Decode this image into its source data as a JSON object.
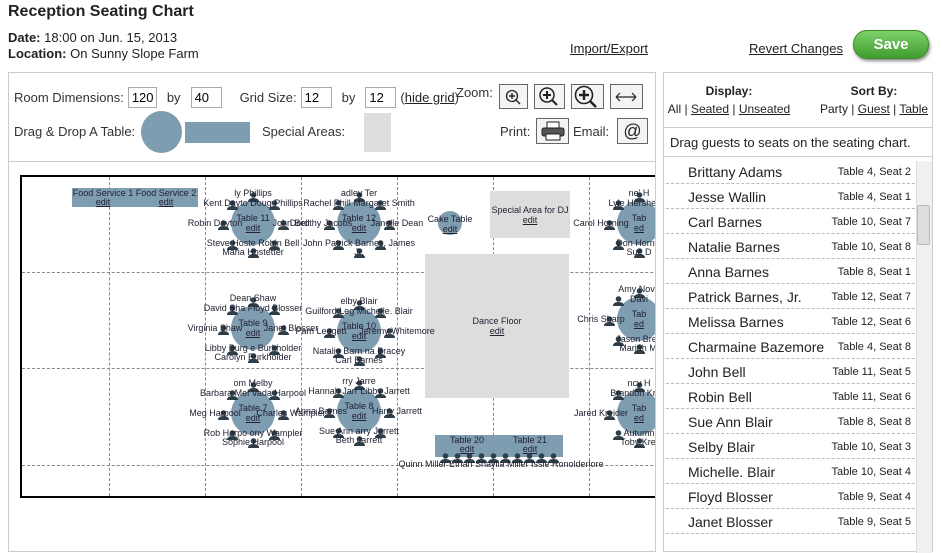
{
  "header": {
    "title": "Reception Seating Chart",
    "date_label": "Date:",
    "date": "18:00 on Jun. 15, 2013",
    "location_label": "Location:",
    "location": "On Sunny Slope Farm",
    "import_export": "Import/Export",
    "revert": "Revert Changes",
    "save": "Save"
  },
  "toolbar": {
    "room_label": "Room Dimensions:",
    "room_w": "120",
    "by1": "by",
    "room_h": "40",
    "grid_label": "Grid Size:",
    "grid_w": "12",
    "by2": "by",
    "grid_h": "12",
    "hide_grid": "hide grid",
    "zoom_label": "Zoom:",
    "drag_label": "Drag & Drop A Table:",
    "special_label": "Special Areas:",
    "print_label": "Print:",
    "email_label": "Email:"
  },
  "colors": {
    "table": "#7f9db0",
    "special_area": "#dddddd",
    "save": "#4aa838"
  },
  "chart": {
    "round_tables": [
      {
        "name": "Table 11",
        "edit": "edit",
        "lines": [
          "ly Phillips",
          "Kent Dayto Doug Phillips",
          "Robin Dayton",
          "John Bell",
          "Steve Hoste Robin Bell",
          "Maria Hostetter"
        ]
      },
      {
        "name": "Table 12",
        "edit": "edit",
        "lines": [
          "adley Ter",
          "Rachel Phill Margaret Smith",
          "Dorothy Jacobs",
          "Janelle Dean",
          "John Patrick Barnes, James",
          "Jr."
        ]
      },
      {
        "name": "Table 9",
        "edit": "edit",
        "lines": [
          "Dean Shaw",
          "David Sha Floyd Blosser",
          "Virginia Shaw",
          "Janet Blosser",
          "Libby Burg e Burkholder",
          "Carolyn Burkholder"
        ]
      },
      {
        "name": "Table 10",
        "edit": "edit",
        "lines": [
          "elby Blair",
          "Guilford Leg Michelle. Blair",
          "Pam Leggett",
          "Jeremy Whitemore",
          "Natalie Barn na Bracey",
          "Carl Barnes"
        ]
      },
      {
        "name": "Table 7",
        "edit": "edit",
        "lines": [
          "om Melby",
          "Barbara Mel Vada Harpool",
          "Meg Harpool",
          "Charles Wampler",
          "Rob Harpo ony Wampler",
          "Sophie Harpool"
        ]
      },
      {
        "name": "Table 8",
        "edit": "edit",
        "lines": [
          "rry Jarre",
          "Hannah Jarr Libby Jarrett",
          "Anna Barnes",
          "Harry Jarrett",
          "Sue Ann arry Jarrett",
          "Beth Jarrett"
        ]
      },
      {
        "name": "Tab",
        "edit": "ed",
        "lines": [
          "ne' H",
          "Lyle Hershey, J",
          "Carol Horning",
          "",
          "Don Hornin",
          "Sue D"
        ]
      },
      {
        "name": "Tab",
        "edit": "ed",
        "lines": [
          "Amy Nove",
          "Davi",
          "Chris Sharp",
          "",
          "Jason Bren",
          "Mariah Mi"
        ]
      },
      {
        "name": "Tab",
        "edit": "ed",
        "lines": [
          "ncy H",
          "Brandon Kreid",
          "Jared Kreider",
          "",
          "Autumn",
          "Toby Krei"
        ]
      }
    ],
    "food_service": [
      {
        "name": "Food Service 1",
        "edit": "edit"
      },
      {
        "name": "Food Service 2",
        "edit": "edit"
      }
    ],
    "cake": {
      "name": "Cake Table",
      "edit": "edit"
    },
    "dj": {
      "name": "Special Area for DJ",
      "edit": "edit"
    },
    "dance": {
      "name": "Dance Floor",
      "edit": "edit"
    },
    "long_tables": [
      {
        "name": "Table 20",
        "edit": "edit"
      },
      {
        "name": "Table 21",
        "edit": "edit"
      }
    ],
    "long_guests": "Quinn Miller  Ethan  Shaylia Miller Issie Ronolderlore"
  },
  "sidebar": {
    "display_label": "Display:",
    "display_all": "All",
    "display_seated": "Seated",
    "display_unseated": "Unseated",
    "sort_label": "Sort By:",
    "sort_party": "Party",
    "sort_guest": "Guest",
    "sort_table": "Table",
    "sep": "|",
    "instructions": "Drag guests to seats on the seating chart.",
    "guests": [
      {
        "name": "Brittany Adams",
        "seat": "Table 4, Seat 2"
      },
      {
        "name": "Jesse Wallin",
        "seat": "Table 4, Seat 1"
      },
      {
        "name": "Carl Barnes",
        "seat": "Table 10, Seat 7"
      },
      {
        "name": "Natalie Barnes",
        "seat": "Table 10, Seat 8"
      },
      {
        "name": "Anna Barnes",
        "seat": "Table 8, Seat 1"
      },
      {
        "name": "Patrick Barnes, Jr.",
        "seat": "Table 12, Seat 7"
      },
      {
        "name": "Melissa Barnes",
        "seat": "Table 12, Seat 6"
      },
      {
        "name": "Charmaine Bazemore",
        "seat": "Table 4, Seat 8"
      },
      {
        "name": "John Bell",
        "seat": "Table 11, Seat 5"
      },
      {
        "name": "Robin Bell",
        "seat": "Table 11, Seat 6"
      },
      {
        "name": "Sue Ann Blair",
        "seat": "Table 8, Seat 8"
      },
      {
        "name": "Selby Blair",
        "seat": "Table 10, Seat 3"
      },
      {
        "name": "Michelle. Blair",
        "seat": "Table 10, Seat 4"
      },
      {
        "name": "Floyd Blosser",
        "seat": "Table 9, Seat 4"
      },
      {
        "name": "Janet Blosser",
        "seat": "Table 9, Seat 5"
      }
    ]
  }
}
